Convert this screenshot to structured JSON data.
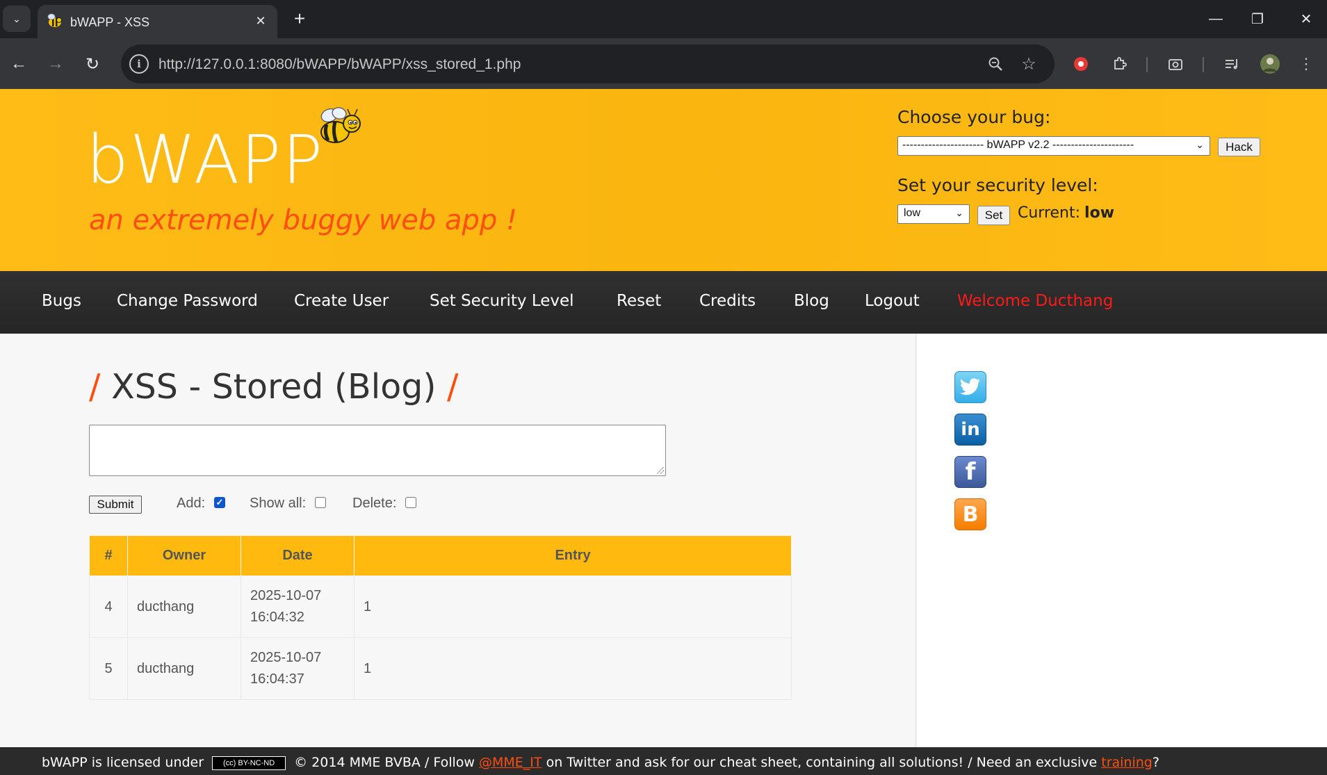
{
  "browser": {
    "tab_title": "bWAPP - XSS",
    "url": "http://127.0.0.1:8080/bWAPP/bWAPP/xss_stored_1.php"
  },
  "header": {
    "logo": "bWAPP",
    "tagline": "an extremely buggy web app !",
    "choose_bug_label": "Choose your bug:",
    "bug_select_value": "---------------------- bWAPP v2.2 ----------------------",
    "hack_button": "Hack",
    "security_label": "Set your security level:",
    "security_select_value": "low",
    "set_button": "Set",
    "current_label": "Current:",
    "current_value": "low"
  },
  "menu": {
    "items": [
      "Bugs",
      "Change Password",
      "Create User",
      "Set Security Level",
      "Reset",
      "Credits",
      "Blog",
      "Logout"
    ],
    "welcome": "Welcome Ducthang"
  },
  "content": {
    "title": "XSS - Stored (Blog)",
    "title_slash": "/",
    "submit_button": "Submit",
    "add_label": "Add:",
    "add_checked": true,
    "show_all_label": "Show all:",
    "show_all_checked": false,
    "delete_label": "Delete:",
    "delete_checked": false
  },
  "table": {
    "headers": [
      "#",
      "Owner",
      "Date",
      "Entry"
    ],
    "rows": [
      {
        "num": "4",
        "owner": "ducthang",
        "date": "2025-10-07",
        "time": "16:04:32",
        "entry": "1"
      },
      {
        "num": "5",
        "owner": "ducthang",
        "date": "2025-10-07",
        "time": "16:04:37",
        "entry": "1"
      }
    ]
  },
  "social": [
    "twitter-icon",
    "linkedin-icon",
    "facebook-icon",
    "blogger-icon"
  ],
  "footer": {
    "part1": "bWAPP is licensed under",
    "badge": "(cc) BY-NC-ND",
    "part2": "© 2014 MME BVBA / Follow",
    "twitter_link": "@MME_IT",
    "part3": "on Twitter and ask for our cheat sheet, containing all solutions! / Need an exclusive",
    "training_link": "training",
    "part4": "?"
  },
  "colors": {
    "header_bg": "#ffb90f",
    "accent": "#ff4e0f",
    "menu_bg": "#2b2b2b",
    "welcome": "#ff1a1a"
  }
}
